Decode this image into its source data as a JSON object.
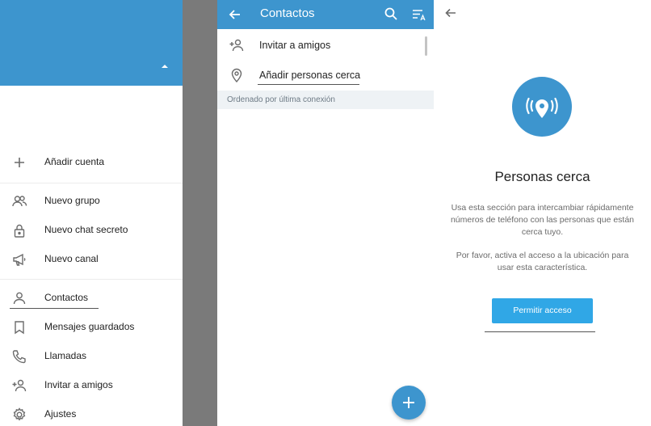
{
  "drawer": {
    "items": [
      {
        "label": "Añadir cuenta",
        "icon": "plus-icon"
      },
      {
        "label": "Nuevo grupo",
        "icon": "group-icon"
      },
      {
        "label": "Nuevo chat secreto",
        "icon": "lock-icon"
      },
      {
        "label": "Nuevo canal",
        "icon": "megaphone-icon"
      },
      {
        "label": "Contactos",
        "icon": "person-icon"
      },
      {
        "label": "Mensajes guardados",
        "icon": "bookmark-icon"
      },
      {
        "label": "Llamadas",
        "icon": "phone-icon"
      },
      {
        "label": "Invitar a amigos",
        "icon": "add-person-icon"
      },
      {
        "label": "Ajustes",
        "icon": "gear-icon"
      }
    ]
  },
  "contacts": {
    "title": "Contactos",
    "rows": [
      {
        "label": "Invitar a amigos",
        "icon": "add-person-icon"
      },
      {
        "label": "Añadir personas cerca",
        "icon": "location-pin-icon"
      }
    ],
    "section_header": "Ordenado por última conexión"
  },
  "nearby": {
    "title": "Personas cerca",
    "description": "Usa esta sección para intercambiar rápidamente números de teléfono con las personas que están cerca tuyo.",
    "permission_note": "Por favor, activa el acceso a la ubicación para usar esta característica.",
    "button_label": "Permitir acceso"
  },
  "colors": {
    "header_blue": "#3d95ce",
    "button_blue": "#30a7e6",
    "dim_overlay": "#7a7a7a"
  }
}
